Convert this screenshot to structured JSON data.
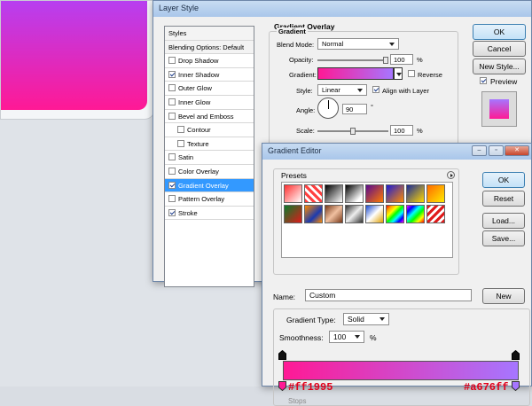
{
  "layer_style": {
    "title": "Layer Style",
    "list": {
      "header": "Styles",
      "blending": "Blending Options: Default",
      "items": [
        {
          "label": "Drop Shadow",
          "checked": false,
          "sub": false
        },
        {
          "label": "Inner Shadow",
          "checked": true,
          "sub": false
        },
        {
          "label": "Outer Glow",
          "checked": false,
          "sub": false
        },
        {
          "label": "Inner Glow",
          "checked": false,
          "sub": false
        },
        {
          "label": "Bevel and Emboss",
          "checked": false,
          "sub": false
        },
        {
          "label": "Contour",
          "checked": false,
          "sub": true
        },
        {
          "label": "Texture",
          "checked": false,
          "sub": true
        },
        {
          "label": "Satin",
          "checked": false,
          "sub": false
        },
        {
          "label": "Color Overlay",
          "checked": false,
          "sub": false
        },
        {
          "label": "Gradient Overlay",
          "checked": true,
          "sub": false,
          "selected": true
        },
        {
          "label": "Pattern Overlay",
          "checked": false,
          "sub": false
        },
        {
          "label": "Stroke",
          "checked": true,
          "sub": false
        }
      ]
    },
    "panel": {
      "title": "Gradient Overlay",
      "group": "Gradient",
      "blend_mode_label": "Blend Mode:",
      "blend_mode_value": "Normal",
      "opacity_label": "Opacity:",
      "opacity_value": "100",
      "opacity_unit": "%",
      "gradient_label": "Gradient:",
      "reverse_label": "Reverse",
      "style_label": "Style:",
      "style_value": "Linear",
      "align_label": "Align with Layer",
      "angle_label": "Angle:",
      "angle_value": "90",
      "angle_unit": "°",
      "scale_label": "Scale:",
      "scale_value": "100",
      "scale_unit": "%"
    },
    "buttons": {
      "ok": "OK",
      "cancel": "Cancel",
      "new_style": "New Style...",
      "preview": "Preview"
    }
  },
  "gradient_editor": {
    "title": "Gradient Editor",
    "presets_label": "Presets",
    "buttons": {
      "ok": "OK",
      "reset": "Reset",
      "load": "Load...",
      "save": "Save...",
      "new": "New"
    },
    "name_label": "Name:",
    "name_value": "Custom",
    "type_label": "Gradient Type:",
    "type_value": "Solid",
    "smoothness_label": "Smoothness:",
    "smoothness_value": "100",
    "smoothness_unit": "%",
    "stops_label": "Stops",
    "stop_left_hex": "#ff1995",
    "stop_right_hex": "#a676ff"
  },
  "colors": {
    "grad_start": "#ff1995",
    "grad_end": "#a676ff",
    "selection": "#3399ff",
    "annotation": "#e0001a"
  }
}
